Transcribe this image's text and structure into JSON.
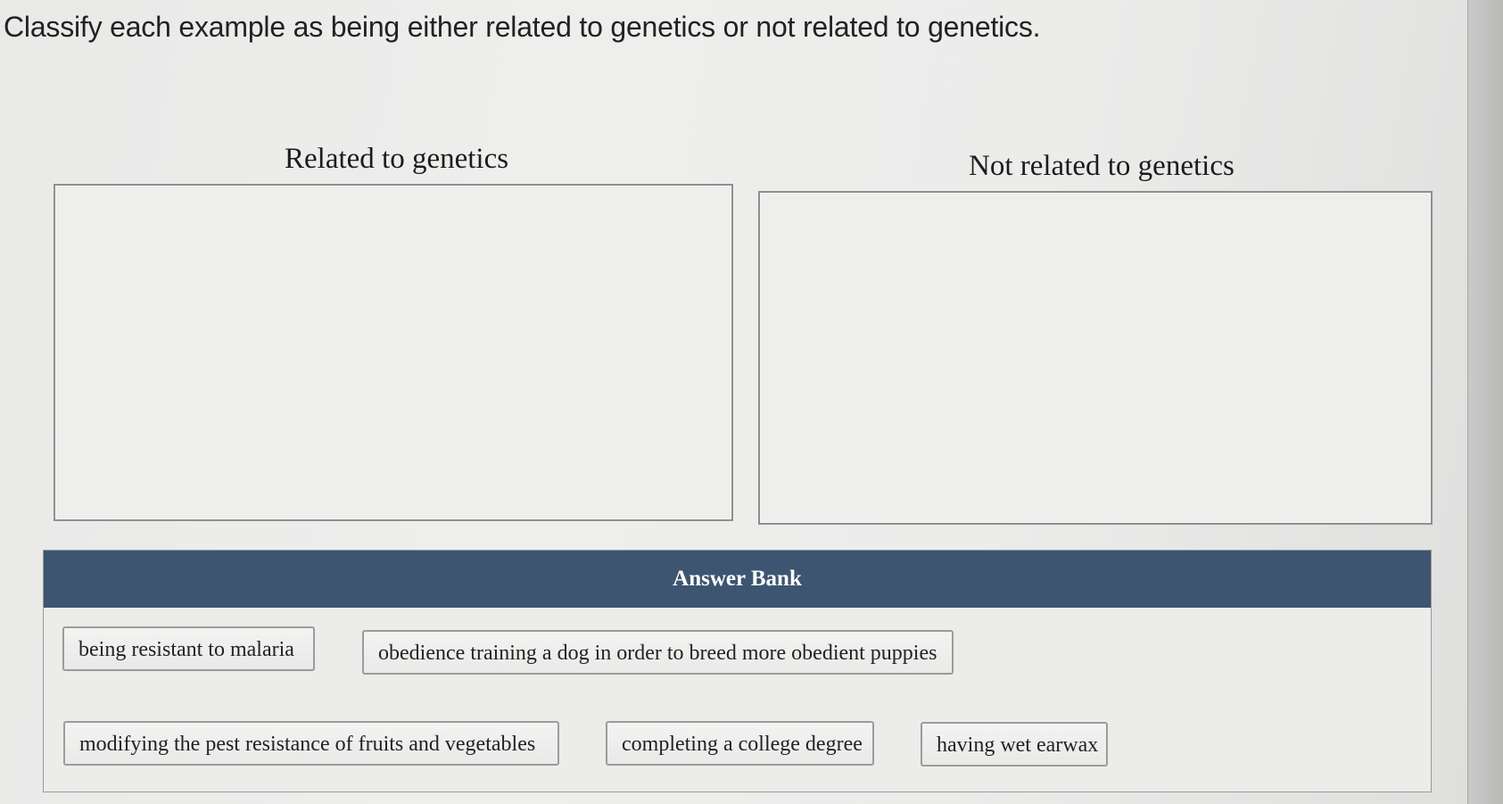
{
  "question": {
    "prompt": "Classify each example as being either related to genetics or not related to genetics."
  },
  "categories": [
    {
      "label": "Related to genetics",
      "items": []
    },
    {
      "label": "Not related to genetics",
      "items": []
    }
  ],
  "answer_bank": {
    "title": "Answer Bank",
    "items": [
      "being resistant to malaria",
      "obedience training a dog in order to breed more obedient puppies",
      "modifying the pest resistance of fruits and vegetables",
      "completing a college degree",
      "having wet earwax"
    ]
  },
  "colors": {
    "bank_header_bg": "#3d5570",
    "bank_header_text": "#ffffff",
    "page_bg": "#ececeb"
  }
}
